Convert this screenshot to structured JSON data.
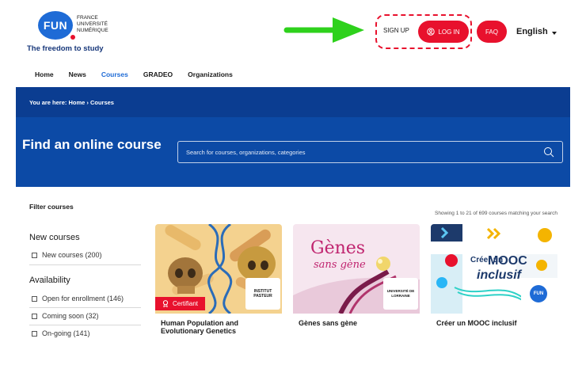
{
  "header": {
    "logo": {
      "abbr": "FUN",
      "line1": "FRANCE",
      "line2": "UNIVERSITÉ",
      "line3": "NUMÉRIQUE",
      "tagline": "The freedom to study"
    },
    "signup_label": "SIGN UP",
    "login_label": "LOG IN",
    "faq_label": "FAQ",
    "language": "English",
    "nav": [
      {
        "label": "Home"
      },
      {
        "label": "News"
      },
      {
        "label": "Courses"
      },
      {
        "label": "GRADEO"
      },
      {
        "label": "Organizations"
      }
    ]
  },
  "hero": {
    "breadcrumb": "You are here:  Home › Courses",
    "title": "Find an online course",
    "search_placeholder": "Search for courses, organizations, categories"
  },
  "filters": {
    "title": "Filter courses",
    "groups": [
      {
        "title": "New courses",
        "items": [
          "New courses (200)"
        ]
      },
      {
        "title": "Availability",
        "items": [
          "Open for enrollment (146)",
          "Coming soon (32)",
          "On-going (141)"
        ]
      }
    ]
  },
  "results": {
    "summary": "Showing 1 to 21 of 699 courses matching your search"
  },
  "courses": [
    {
      "title": "Human Population and Evolutionary Genetics",
      "badge": "Certifiant",
      "org": "INSTITUT PASTEUR"
    },
    {
      "title": "Gènes sans gène",
      "org": "UNIVERSITÉ DE LORRAINE",
      "art_line1": "Gènes",
      "art_line2": "sans gène"
    },
    {
      "title": "Créer un MOOC inclusif",
      "org": "FUN",
      "art_line1": "Créer un",
      "art_line2": "MOOC",
      "art_line3": "inclusif"
    }
  ],
  "colors": {
    "brand_red": "#e8112d",
    "brand_blue": "#1e6bd6",
    "hero_dark": "#0b3d91",
    "hero": "#0c4aa6",
    "arrow_green": "#2ed11c"
  }
}
